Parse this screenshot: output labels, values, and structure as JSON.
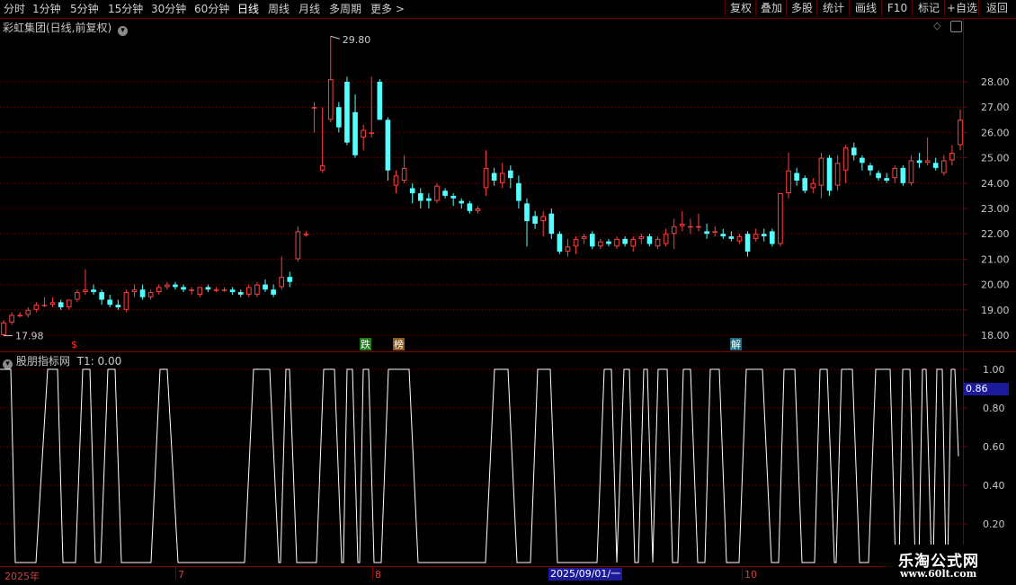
{
  "toolbar": {
    "periods": [
      "分时",
      "1分钟",
      "5分钟",
      "15分钟",
      "30分钟",
      "60分钟",
      "日线",
      "周线",
      "月线",
      "多周期",
      "更多 >"
    ],
    "active_period": "日线",
    "buttons": [
      "复权",
      "叠加",
      "多股",
      "统计",
      "画线",
      "F10",
      "标记",
      "+自选",
      "返回"
    ]
  },
  "stock": {
    "title": "彩虹集团(日线,前复权)",
    "high_label": "29.80",
    "low_label": "17.98"
  },
  "events": [
    {
      "text": "$",
      "color": "#ff3030",
      "bg": "transparent"
    },
    {
      "text": "跌",
      "color": "#ffffff",
      "bg": "#1a7a1a"
    },
    {
      "text": "榜",
      "color": "#ffffff",
      "bg": "#8a5a1a"
    },
    {
      "text": "解",
      "color": "#ffffff",
      "bg": "#1a6a7a"
    }
  ],
  "indicator": {
    "title": "股朋指标网",
    "value_label": "T1: 0.00",
    "current_value": "0.86",
    "y_ticks": [
      "1.00",
      "0.80",
      "0.60",
      "0.40",
      "0.20"
    ]
  },
  "price_axis": {
    "ticks": [
      "28.00",
      "27.00",
      "26.00",
      "25.00",
      "24.00",
      "23.00",
      "22.00",
      "21.00",
      "20.00",
      "19.00",
      "18.00"
    ],
    "values": [
      28,
      27,
      26,
      25,
      24,
      23,
      22,
      21,
      20,
      19,
      18
    ]
  },
  "date_axis": {
    "labels": [
      "2025年",
      "7",
      "8",
      "10"
    ],
    "cursor_date": "2025/09/01/一"
  },
  "watermark": {
    "text": "乐淘公式网",
    "url": "www.60lt.com"
  },
  "colors": {
    "up": "#ff4040",
    "down": "#54ffff",
    "grid": "#7a0000",
    "indicator_line": "#ffffff"
  },
  "candles": [
    [
      18.0,
      18.6,
      17.98,
      18.5
    ],
    [
      18.5,
      18.9,
      18.4,
      18.8
    ],
    [
      18.8,
      18.9,
      18.7,
      18.8
    ],
    [
      18.8,
      19.1,
      18.7,
      19.0
    ],
    [
      19.0,
      19.3,
      18.9,
      19.2
    ],
    [
      19.2,
      19.5,
      19.1,
      19.2
    ],
    [
      19.2,
      19.5,
      19.1,
      19.3
    ],
    [
      19.3,
      19.4,
      19.0,
      19.1
    ],
    [
      19.1,
      19.4,
      19.0,
      19.4
    ],
    [
      19.4,
      19.8,
      19.3,
      19.7
    ],
    [
      19.7,
      20.6,
      19.6,
      19.8
    ],
    [
      19.8,
      20.0,
      19.6,
      19.7
    ],
    [
      19.7,
      19.8,
      19.2,
      19.4
    ],
    [
      19.4,
      19.6,
      19.1,
      19.2
    ],
    [
      19.2,
      19.4,
      19.0,
      19.1
    ],
    [
      19.0,
      19.8,
      18.9,
      19.7
    ],
    [
      19.7,
      20.0,
      19.5,
      19.8
    ],
    [
      19.8,
      20.0,
      19.4,
      19.5
    ],
    [
      19.5,
      19.8,
      19.4,
      19.7
    ],
    [
      19.7,
      20.0,
      19.6,
      19.9
    ],
    [
      19.9,
      20.1,
      19.8,
      20.0
    ],
    [
      20.0,
      20.1,
      19.8,
      19.9
    ],
    [
      19.9,
      20.0,
      19.7,
      19.8
    ],
    [
      19.8,
      19.9,
      19.6,
      19.8
    ],
    [
      19.6,
      19.9,
      19.5,
      19.9
    ],
    [
      19.9,
      20.0,
      19.7,
      19.8
    ],
    [
      19.8,
      19.9,
      19.7,
      19.8
    ],
    [
      19.8,
      19.9,
      19.7,
      19.8
    ],
    [
      19.8,
      19.9,
      19.6,
      19.7
    ],
    [
      19.7,
      19.8,
      19.5,
      19.6
    ],
    [
      19.6,
      20.0,
      19.5,
      19.9
    ],
    [
      19.6,
      20.1,
      19.5,
      20.0
    ],
    [
      20.0,
      20.2,
      19.7,
      19.8
    ],
    [
      19.8,
      20.0,
      19.5,
      19.6
    ],
    [
      19.9,
      21.1,
      19.8,
      20.3
    ],
    [
      20.3,
      20.5,
      19.9,
      20.1
    ],
    [
      21.0,
      22.3,
      20.9,
      22.1
    ],
    [
      22.0,
      22.1,
      21.9,
      22.0
    ],
    [
      27.0,
      27.2,
      26.0,
      27.0
    ],
    [
      24.5,
      27.0,
      24.4,
      24.7
    ],
    [
      26.5,
      29.8,
      26.4,
      28.1
    ],
    [
      27.0,
      27.2,
      26.0,
      26.2
    ],
    [
      28.0,
      28.2,
      25.5,
      25.6
    ],
    [
      26.8,
      27.5,
      25.0,
      25.1
    ],
    [
      25.8,
      26.3,
      25.3,
      26.1
    ],
    [
      26.0,
      28.2,
      25.8,
      26.0
    ],
    [
      28.0,
      28.1,
      26.5,
      26.5
    ],
    [
      26.5,
      26.6,
      24.1,
      24.5
    ],
    [
      23.9,
      24.5,
      23.6,
      24.3
    ],
    [
      24.1,
      25.1,
      24.0,
      24.6
    ],
    [
      23.8,
      24.0,
      23.2,
      23.6
    ],
    [
      23.6,
      23.8,
      23.0,
      23.3
    ],
    [
      23.4,
      23.6,
      23.0,
      23.3
    ],
    [
      23.3,
      24.0,
      23.2,
      23.9
    ],
    [
      23.7,
      23.8,
      23.4,
      23.5
    ],
    [
      23.5,
      23.6,
      23.1,
      23.4
    ],
    [
      23.3,
      23.4,
      23.0,
      23.2
    ],
    [
      23.2,
      23.3,
      22.8,
      22.9
    ],
    [
      22.9,
      23.1,
      22.8,
      23.0
    ],
    [
      23.8,
      25.3,
      23.5,
      24.6
    ],
    [
      24.4,
      24.6,
      23.9,
      24.1
    ],
    [
      24.0,
      24.8,
      23.8,
      24.4
    ],
    [
      24.5,
      24.7,
      23.8,
      24.2
    ],
    [
      24.0,
      24.3,
      23.0,
      23.3
    ],
    [
      23.2,
      23.4,
      21.5,
      22.5
    ],
    [
      22.7,
      22.9,
      22.2,
      22.4
    ],
    [
      22.5,
      22.9,
      21.9,
      22.7
    ],
    [
      22.8,
      23.0,
      21.8,
      22.0
    ],
    [
      22.0,
      22.1,
      21.2,
      21.3
    ],
    [
      21.3,
      21.8,
      21.1,
      21.5
    ],
    [
      21.5,
      21.9,
      21.2,
      21.8
    ],
    [
      21.8,
      22.0,
      21.6,
      21.9
    ],
    [
      22.0,
      22.1,
      21.4,
      21.5
    ],
    [
      21.5,
      21.8,
      21.4,
      21.7
    ],
    [
      21.7,
      21.8,
      21.5,
      21.6
    ],
    [
      21.5,
      21.9,
      21.4,
      21.8
    ],
    [
      21.8,
      21.9,
      21.5,
      21.6
    ],
    [
      21.5,
      21.9,
      21.3,
      21.8
    ],
    [
      21.8,
      22.0,
      21.6,
      21.9
    ],
    [
      21.9,
      22.0,
      21.5,
      21.6
    ],
    [
      21.5,
      21.9,
      21.4,
      21.8
    ],
    [
      21.6,
      22.2,
      21.5,
      22.0
    ],
    [
      22.0,
      22.6,
      21.4,
      22.3
    ],
    [
      22.3,
      22.9,
      22.1,
      22.4
    ],
    [
      22.3,
      22.6,
      22.0,
      22.3
    ],
    [
      22.3,
      22.8,
      22.1,
      22.3
    ],
    [
      22.1,
      22.4,
      21.8,
      22.0
    ],
    [
      22.1,
      22.3,
      21.9,
      22.1
    ],
    [
      22.0,
      22.2,
      21.8,
      21.9
    ],
    [
      21.9,
      22.1,
      21.7,
      21.8
    ],
    [
      21.7,
      22.0,
      21.6,
      21.9
    ],
    [
      22.0,
      22.1,
      21.1,
      21.3
    ],
    [
      21.8,
      22.2,
      21.7,
      22.0
    ],
    [
      22.0,
      22.2,
      21.7,
      21.9
    ],
    [
      22.1,
      22.2,
      21.5,
      21.6
    ],
    [
      21.6,
      23.6,
      21.5,
      23.6
    ],
    [
      23.6,
      25.2,
      23.4,
      24.5
    ],
    [
      24.4,
      24.6,
      23.9,
      24.1
    ],
    [
      24.2,
      24.3,
      23.6,
      23.7
    ],
    [
      23.8,
      24.2,
      23.6,
      24.0
    ],
    [
      23.9,
      25.2,
      23.4,
      25.0
    ],
    [
      25.0,
      25.1,
      23.5,
      23.7
    ],
    [
      23.9,
      25.1,
      23.7,
      24.8
    ],
    [
      24.5,
      25.5,
      24.0,
      25.4
    ],
    [
      25.4,
      25.6,
      24.9,
      25.1
    ],
    [
      25.0,
      25.1,
      24.5,
      24.8
    ],
    [
      24.7,
      24.8,
      24.3,
      24.5
    ],
    [
      24.4,
      24.5,
      24.1,
      24.2
    ],
    [
      24.2,
      24.4,
      24.0,
      24.1
    ],
    [
      24.2,
      24.7,
      24.0,
      24.6
    ],
    [
      24.6,
      24.7,
      23.9,
      24.0
    ],
    [
      24.0,
      25.1,
      23.9,
      24.9
    ],
    [
      24.9,
      25.2,
      24.6,
      24.8
    ],
    [
      24.8,
      25.8,
      24.7,
      24.9
    ],
    [
      24.8,
      25.0,
      24.5,
      24.6
    ],
    [
      24.4,
      25.1,
      24.3,
      24.9
    ],
    [
      24.9,
      25.5,
      24.7,
      25.2
    ],
    [
      25.5,
      26.9,
      25.3,
      26.5
    ]
  ],
  "indicator_path": [
    [
      0,
      1
    ],
    [
      12,
      1
    ],
    [
      17,
      0
    ],
    [
      40,
      0
    ],
    [
      53,
      1
    ],
    [
      64,
      1
    ],
    [
      70,
      0
    ],
    [
      84,
      0
    ],
    [
      92,
      1
    ],
    [
      100,
      1
    ],
    [
      106,
      0
    ],
    [
      112,
      0
    ],
    [
      120,
      1
    ],
    [
      128,
      1
    ],
    [
      135,
      0
    ],
    [
      168,
      0
    ],
    [
      178,
      1
    ],
    [
      186,
      1
    ],
    [
      198,
      0
    ],
    [
      272,
      0
    ],
    [
      282,
      1
    ],
    [
      300,
      1
    ],
    [
      310,
      0
    ],
    [
      312,
      0
    ],
    [
      318,
      1
    ],
    [
      322,
      1
    ],
    [
      330,
      0
    ],
    [
      352,
      0
    ],
    [
      360,
      1
    ],
    [
      372,
      1
    ],
    [
      380,
      0
    ],
    [
      382,
      0
    ],
    [
      386,
      1
    ],
    [
      392,
      1
    ],
    [
      398,
      0
    ],
    [
      400,
      0
    ],
    [
      404,
      1
    ],
    [
      410,
      1
    ],
    [
      416,
      0
    ],
    [
      424,
      0
    ],
    [
      432,
      1
    ],
    [
      455,
      1
    ],
    [
      465,
      0
    ],
    [
      540,
      0
    ],
    [
      550,
      1
    ],
    [
      565,
      1
    ],
    [
      575,
      0
    ],
    [
      590,
      0
    ],
    [
      598,
      1
    ],
    [
      612,
      1
    ],
    [
      620,
      0
    ],
    [
      664,
      0
    ],
    [
      672,
      1
    ],
    [
      680,
      1
    ],
    [
      686,
      0
    ],
    [
      694,
      1
    ],
    [
      700,
      1
    ],
    [
      706,
      0
    ],
    [
      710,
      0
    ],
    [
      716,
      1
    ],
    [
      720,
      1
    ],
    [
      726,
      0
    ],
    [
      732,
      1
    ],
    [
      742,
      1
    ],
    [
      748,
      0
    ],
    [
      754,
      0
    ],
    [
      760,
      1
    ],
    [
      768,
      1
    ],
    [
      776,
      0
    ],
    [
      784,
      0
    ],
    [
      790,
      1
    ],
    [
      800,
      1
    ],
    [
      808,
      0
    ],
    [
      822,
      0
    ],
    [
      830,
      1
    ],
    [
      848,
      1
    ],
    [
      858,
      0
    ],
    [
      866,
      0
    ],
    [
      872,
      1
    ],
    [
      884,
      1
    ],
    [
      892,
      0
    ],
    [
      906,
      0
    ],
    [
      912,
      1
    ],
    [
      920,
      1
    ],
    [
      928,
      0
    ],
    [
      930,
      0
    ],
    [
      936,
      1
    ],
    [
      948,
      1
    ],
    [
      956,
      0
    ],
    [
      966,
      0
    ],
    [
      974,
      1
    ],
    [
      990,
      1
    ],
    [
      996,
      0
    ],
    [
      1000,
      0
    ],
    [
      1004,
      1
    ],
    [
      1012,
      1
    ],
    [
      1018,
      0
    ],
    [
      1022,
      0
    ],
    [
      1026,
      1
    ],
    [
      1030,
      1
    ],
    [
      1036,
      0
    ],
    [
      1038,
      0
    ],
    [
      1042,
      1
    ],
    [
      1048,
      1
    ],
    [
      1052,
      0
    ],
    [
      1054,
      0
    ],
    [
      1058,
      1
    ],
    [
      1062,
      1
    ],
    [
      1066,
      0.55
    ]
  ]
}
